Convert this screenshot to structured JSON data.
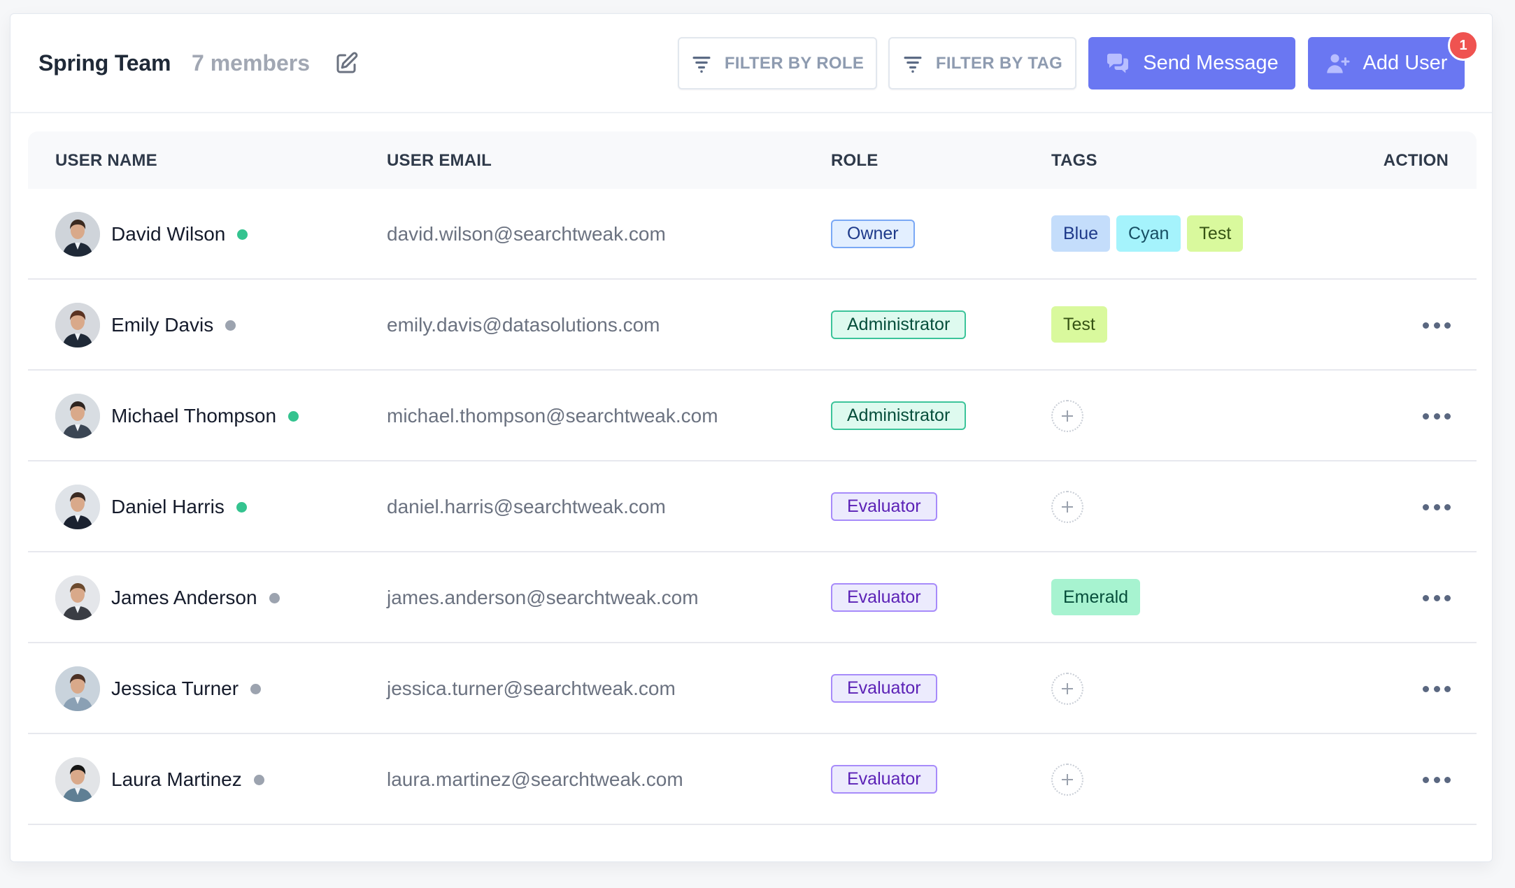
{
  "header": {
    "title": "Spring Team",
    "member_count": "7 members",
    "edit_icon": "edit-icon",
    "buttons": {
      "filter_role": {
        "label": "FILTER BY ROLE",
        "icon": "filter-icon"
      },
      "filter_tag": {
        "label": "FILTER BY TAG",
        "icon": "filter-icon"
      },
      "send_message": {
        "label": "Send Message",
        "icon": "chat-bubbles-icon"
      },
      "add_user": {
        "label": "Add User",
        "icon": "user-plus-icon",
        "badge": "1"
      }
    }
  },
  "table": {
    "columns": [
      "USER NAME",
      "USER EMAIL",
      "ROLE",
      "TAGS",
      "ACTION"
    ],
    "rows": [
      {
        "name": "David Wilson",
        "online": true,
        "email": "david.wilson@searchtweak.com",
        "role": "Owner",
        "tags": [
          "Blue",
          "Cyan",
          "Test"
        ],
        "has_action": false
      },
      {
        "name": "Emily Davis",
        "online": false,
        "email": "emily.davis@datasolutions.com",
        "role": "Administrator",
        "tags": [
          "Test"
        ],
        "has_action": true
      },
      {
        "name": "Michael Thompson",
        "online": true,
        "email": "michael.thompson@searchtweak.com",
        "role": "Administrator",
        "tags": [],
        "has_action": true
      },
      {
        "name": "Daniel Harris",
        "online": true,
        "email": "daniel.harris@searchtweak.com",
        "role": "Evaluator",
        "tags": [],
        "has_action": true
      },
      {
        "name": "James Anderson",
        "online": false,
        "email": "james.anderson@searchtweak.com",
        "role": "Evaluator",
        "tags": [
          "Emerald"
        ],
        "has_action": true
      },
      {
        "name": "Jessica Turner",
        "online": false,
        "email": "jessica.turner@searchtweak.com",
        "role": "Evaluator",
        "tags": [],
        "has_action": true
      },
      {
        "name": "Laura Martinez",
        "online": false,
        "email": "laura.martinez@searchtweak.com",
        "role": "Evaluator",
        "tags": [],
        "has_action": true
      }
    ]
  },
  "colors": {
    "primary": "#6a77f2",
    "badge": "#ef5350",
    "online": "#34c38f",
    "offline": "#9ca3af",
    "roles": {
      "Owner": {
        "bg": "#e3efff",
        "border": "#7aa8f5",
        "text": "#1e3a8a"
      },
      "Administrator": {
        "bg": "#defaef",
        "border": "#3cc49a",
        "text": "#064e3b"
      },
      "Evaluator": {
        "bg": "#ecebfd",
        "border": "#a78bfa",
        "text": "#5b21b6"
      }
    },
    "tags": {
      "Blue": {
        "bg": "#c4ddfb",
        "text": "#1e3a8a"
      },
      "Cyan": {
        "bg": "#a5f3fc",
        "text": "#164e63"
      },
      "Test": {
        "bg": "#d9f99d",
        "text": "#365314"
      },
      "Emerald": {
        "bg": "#a7f3d0",
        "text": "#064e3b"
      }
    }
  }
}
